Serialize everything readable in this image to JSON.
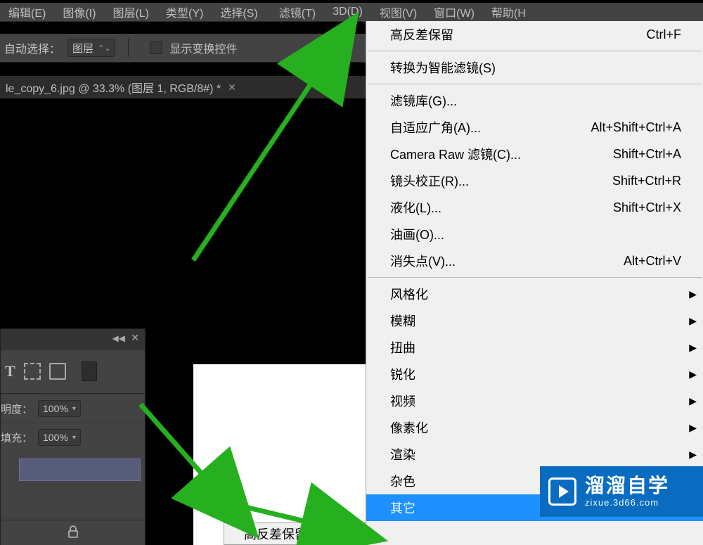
{
  "menubar": {
    "items": [
      {
        "label": "编辑(E)"
      },
      {
        "label": "图像(I)"
      },
      {
        "label": "图层(L)"
      },
      {
        "label": "类型(Y)"
      },
      {
        "label": "选择(S)"
      },
      {
        "label": "滤镜(T)",
        "selected": true
      },
      {
        "label": "3D(D)"
      },
      {
        "label": "视图(V)"
      },
      {
        "label": "窗口(W)"
      },
      {
        "label": "帮助(H"
      }
    ]
  },
  "options": {
    "auto_select_label": "自动选择：",
    "dropdown_value": "图层",
    "show_transform_label": "显示变换控件"
  },
  "doc_tab": {
    "title": "le_copy_6.jpg @ 33.3% (图层 1, RGB/8#) *"
  },
  "panel": {
    "opacity_label": "明度：",
    "opacity_value": "100%",
    "fill_label": "填充：",
    "fill_value": "100%",
    "icons": [
      "type-icon",
      "bounds-icon",
      "page-icon",
      "swatch"
    ]
  },
  "filter_menu": {
    "groups": [
      [
        {
          "label": "高反差保留",
          "shortcut": "Ctrl+F"
        }
      ],
      [
        {
          "label": "转换为智能滤镜(S)"
        }
      ],
      [
        {
          "label": "滤镜库(G)..."
        },
        {
          "label": "自适应广角(A)...",
          "shortcut": "Alt+Shift+Ctrl+A"
        },
        {
          "label": "Camera Raw 滤镜(C)...",
          "shortcut": "Shift+Ctrl+A"
        },
        {
          "label": "镜头校正(R)...",
          "shortcut": "Shift+Ctrl+R"
        },
        {
          "label": "液化(L)...",
          "shortcut": "Shift+Ctrl+X"
        },
        {
          "label": "油画(O)..."
        },
        {
          "label": "消失点(V)...",
          "shortcut": "Alt+Ctrl+V"
        }
      ],
      [
        {
          "label": "风格化",
          "submenu": true
        },
        {
          "label": "模糊",
          "submenu": true
        },
        {
          "label": "扭曲",
          "submenu": true
        },
        {
          "label": "锐化",
          "submenu": true
        },
        {
          "label": "视频",
          "submenu": true
        },
        {
          "label": "像素化",
          "submenu": true
        },
        {
          "label": "渲染",
          "submenu": true
        },
        {
          "label": "杂色",
          "submenu": true
        },
        {
          "label": "其它",
          "submenu": true,
          "highlight": true
        }
      ]
    ]
  },
  "hover_menu": {
    "label": "高反差保留..."
  },
  "watermark": {
    "title": "溜溜自学",
    "url": "zixue.3d66.com"
  }
}
